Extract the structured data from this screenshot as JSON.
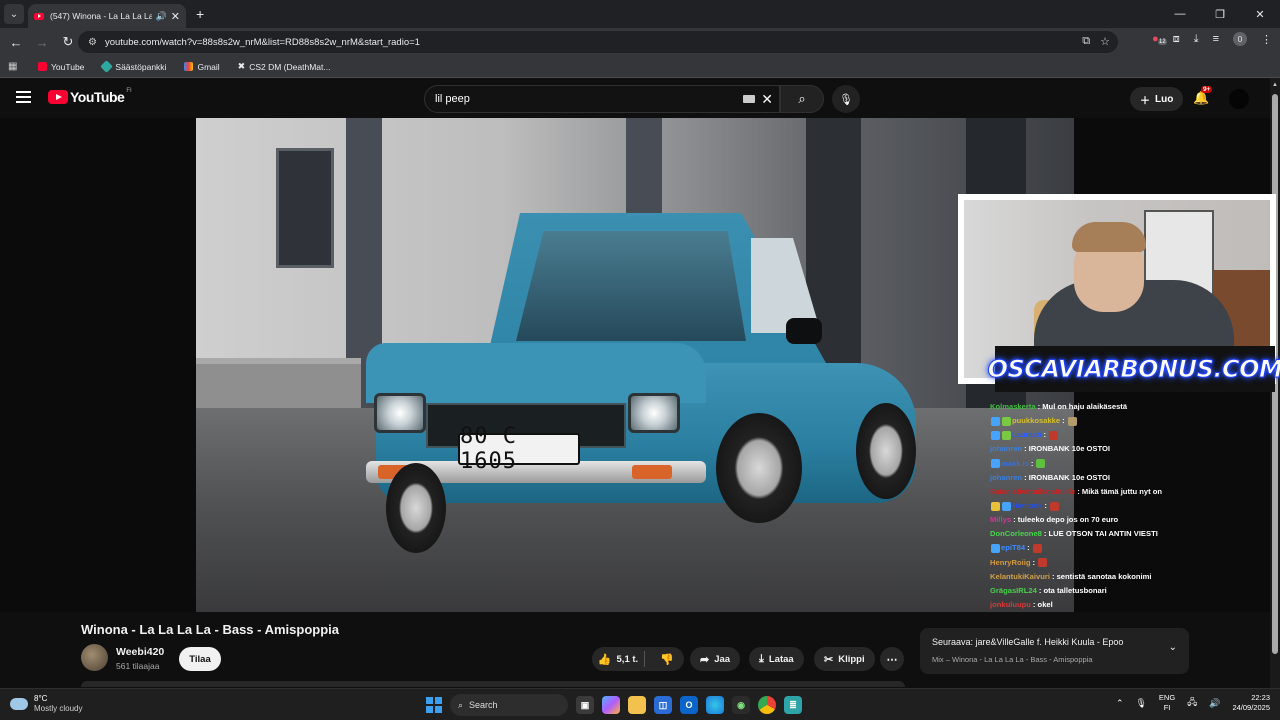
{
  "browser": {
    "tab_title": "(547) Winona - La La La La",
    "url": "youtube.com/watch?v=88s8s2w_nrM&list=RD88s8s2w_nrM&start_radio=1",
    "profile_initial": "0",
    "extension_badge": "12",
    "bookmarks": [
      {
        "label": "YouTube",
        "icon": "youtube-icon",
        "color": "#ff0033"
      },
      {
        "label": "Säästöpankki",
        "icon": "bank-icon",
        "color": "#2fa8a0"
      },
      {
        "label": "Gmail",
        "icon": "gmail-icon",
        "color": "#ea4335"
      },
      {
        "label": "CS2 DM (DeathMat...",
        "icon": "cs2-icon",
        "color": "#dddddd"
      }
    ]
  },
  "youtube": {
    "logo_text": "YouTube",
    "country_code": "FI",
    "search_value": "lil peep",
    "create_label": "Luo",
    "notifications_badge": "9+"
  },
  "video": {
    "plate_text": "80 C 1605",
    "title": "Winona - La La La La - Bass - Amispoppia",
    "channel_name": "Weebi420",
    "subscribers": "561 tilaajaa",
    "subscribe_label": "Tilaa",
    "likes": "5,1 t.",
    "share_label": "Jaa",
    "download_label": "Lataa",
    "clip_label": "Klippi"
  },
  "up_next": {
    "title": "Seuraava: jare&VilleGalle f. Heikki Kuula - Epoo",
    "subtitle": "Mix – Winona - La La La La - Bass - Amispoppia"
  },
  "stream_overlay": {
    "promo_text": "OSCAVIARBONUS.COM",
    "chat": [
      {
        "user": "Kolmaskerta",
        "text": ": Mul on haju alaikäsestä",
        "color": "#3fbf3f",
        "badges": []
      },
      {
        "user": "puukkosakke",
        "text": ":",
        "color": "#d6c025",
        "badges": [
          "#46a4ff",
          "#7ac943"
        ],
        "emote": "#b39b6a"
      },
      {
        "user": "Laurasti",
        "text": ":",
        "color": "#2c5cff",
        "badges": [
          "#46a4ff",
          "#7ac943"
        ],
        "emote": "#c0392b"
      },
      {
        "user": "johanren",
        "text": ": IRONBANK 10e OSTOI",
        "color": "#3c7fd9",
        "badges": []
      },
      {
        "user": "makk.ls",
        "text": ":",
        "color": "#3a6fd6",
        "badges": [
          "#46a4ff"
        ],
        "emote": "#5fbf3f"
      },
      {
        "user": "johanren",
        "text": ": IRONBANK 10e OSTOI",
        "color": "#3c7fd9",
        "badges": []
      },
      {
        "user": "Satanistivittuiliatattuille",
        "text": ": Mikä tämä juttu nyt on",
        "color": "#d11f1f",
        "badges": []
      },
      {
        "user": "Hantonk",
        "text": ":",
        "color": "#2a4fd8",
        "badges": [
          "#e8c13a",
          "#46a4ff"
        ],
        "emote": "#c0392b"
      },
      {
        "user": "Millys",
        "text": ": tuleeko depo jos on 70 euro",
        "color": "#d8329e",
        "badges": []
      },
      {
        "user": "DonCorleone8",
        "text": ": LUE OTSON TAI ANTIN VIESTI",
        "color": "#48d64b",
        "badges": []
      },
      {
        "user": "epiT84",
        "text": ":",
        "color": "#3a8cff",
        "badges": [
          "#46a4ff"
        ],
        "emote": "#c0392b"
      },
      {
        "user": "HenryRoiig",
        "text": ":",
        "color": "#d59b3d",
        "badges": [],
        "emote": "#c0392b"
      },
      {
        "user": "KelantukiKaivuri",
        "text": ": sentistä sanotaa kokonimi",
        "color": "#d1a04b",
        "badges": []
      },
      {
        "user": "GrägasIRL24",
        "text": ": ota talletusbonari",
        "color": "#49d04b",
        "badges": []
      },
      {
        "user": "jonkuluupu",
        "text": ": okel",
        "color": "#d23b3b",
        "badges": []
      }
    ]
  },
  "taskbar": {
    "temperature": "8°C",
    "condition": "Mostly cloudy",
    "search_label": "Search",
    "lang_top": "ENG",
    "lang_bottom": "FI",
    "time": "22:23",
    "date": "24/09/2025"
  }
}
